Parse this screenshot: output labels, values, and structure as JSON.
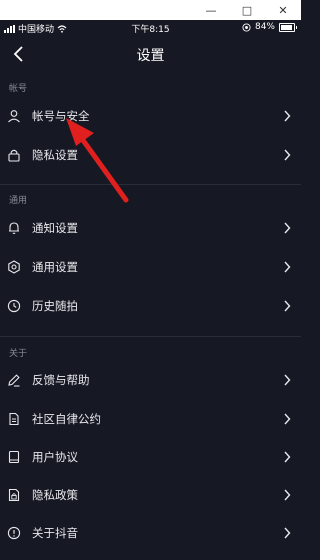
{
  "window": {
    "minimize": "—",
    "maximize": "□",
    "close": "✕"
  },
  "status": {
    "carrier": "中国移动",
    "time": "下午8:15",
    "battery": "84%",
    "battery_level": 0.84
  },
  "header": {
    "title": "设置"
  },
  "sections": [
    {
      "title": "帐号",
      "items": [
        {
          "label": "帐号与安全",
          "icon": "user-icon"
        },
        {
          "label": "隐私设置",
          "icon": "lock-icon"
        }
      ]
    },
    {
      "title": "通用",
      "items": [
        {
          "label": "通知设置",
          "icon": "bell-icon"
        },
        {
          "label": "通用设置",
          "icon": "gear-icon"
        },
        {
          "label": "历史随拍",
          "icon": "clock-icon"
        }
      ]
    },
    {
      "title": "关于",
      "items": [
        {
          "label": "反馈与帮助",
          "icon": "pencil-icon"
        },
        {
          "label": "社区自律公约",
          "icon": "document-icon"
        },
        {
          "label": "用户协议",
          "icon": "book-icon"
        },
        {
          "label": "隐私政策",
          "icon": "privacy-document-icon"
        },
        {
          "label": "关于抖音",
          "icon": "info-icon"
        }
      ]
    }
  ],
  "colors": {
    "background": "#161823",
    "text": "#e8e8ec",
    "section": "#8a8b93",
    "arrow": "#e0201e"
  }
}
